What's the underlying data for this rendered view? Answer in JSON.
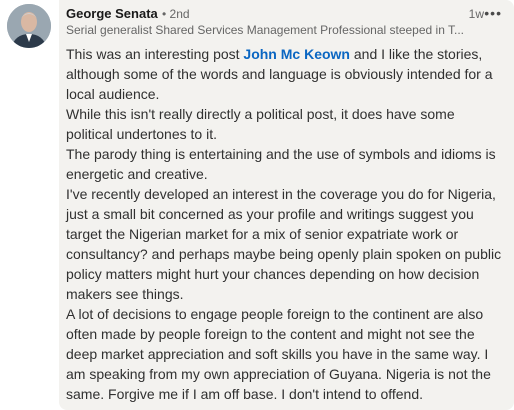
{
  "comment": {
    "author": "George Senata",
    "degree": "• 2nd",
    "headline": "Serial generalist Shared Services Management Professional steeped in T...",
    "time": "1w",
    "more_menu": "•••",
    "body_lines": [
      [
        "This was an interesting post ",
        "John Mc Keown",
        " and I like the stories,"
      ],
      "although some of the words and language is obviously intended for a",
      "local audience.",
      "While this isn't really directly a political post, it does have some",
      "political undertones to it.",
      "The parody thing is entertaining and the use of symbols and idioms is",
      "energetic and creative.",
      "I've recently developed an interest in the coverage you do for Nigeria,",
      "just a small bit concerned as your profile and writings suggest you",
      "target the Nigerian market for a mix of senior expatriate work or",
      "consultancy? and perhaps maybe being openly plain spoken on public",
      "policy matters might hurt your chances depending on how decision",
      "makers see things.",
      "A lot of decisions to engage people foreign to the continent are also",
      "often made by people foreign to the content and might not see the",
      "deep market appreciation and soft skills you have in the same way. I",
      "am speaking from my own appreciation of Guyana. Nigeria is not the",
      "same. Forgive me if I am off base. I don't intend to offend."
    ]
  },
  "colors": {
    "card_bg": "#f3f2ef",
    "mention": "#0a66c2",
    "text": "#303030",
    "meta": "#666666"
  },
  "icons": {
    "avatar": "profile-photo",
    "more": "more-horizontal-icon"
  }
}
